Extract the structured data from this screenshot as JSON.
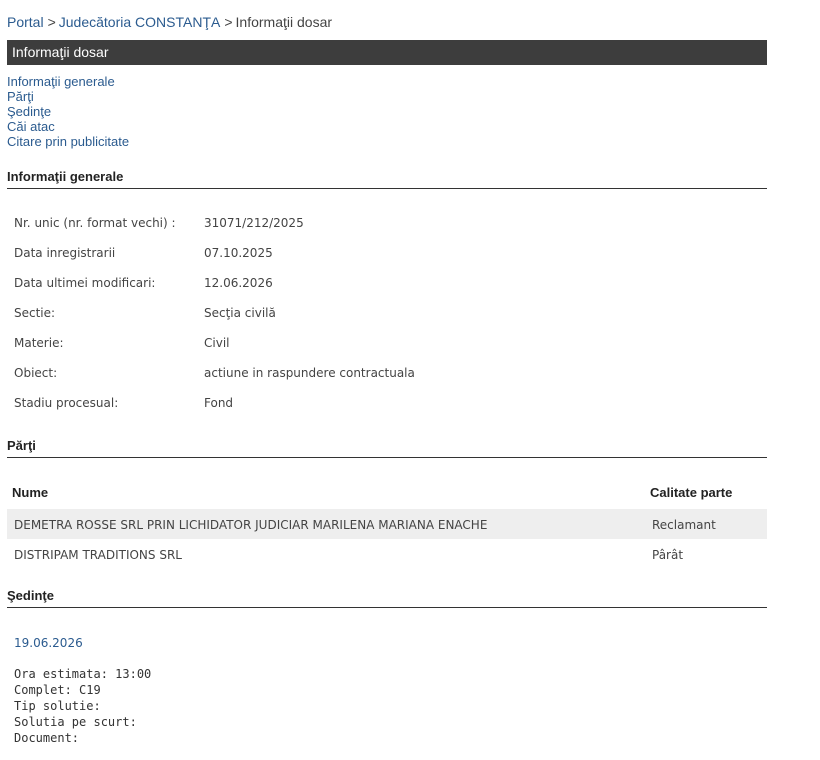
{
  "breadcrumb": {
    "portal": "Portal",
    "sep": ">",
    "court": "Judecătoria CONSTANŢA",
    "current": "Informaţii dosar"
  },
  "title_bar": "Informaţii dosar",
  "nav_links": [
    "Informaţii generale",
    "Părţi",
    "Şedinţe",
    "Căi atac",
    "Citare prin publicitate"
  ],
  "sections": {
    "general": "Informaţii generale",
    "parti": "Părţi",
    "sedinte": "Şedinţe"
  },
  "info": [
    {
      "label": "Nr. unic (nr. format vechi) :",
      "value": "31071/212/2025"
    },
    {
      "label": "Data inregistrarii",
      "value": "07.10.2025"
    },
    {
      "label": "Data ultimei modificari:",
      "value": "12.06.2026"
    },
    {
      "label": "Sectie:",
      "value": "Secţia civilă"
    },
    {
      "label": "Materie:",
      "value": "Civil"
    },
    {
      "label": "Obiect:",
      "value": "actiune in raspundere contractuala"
    },
    {
      "label": "Stadiu procesual:",
      "value": "Fond"
    }
  ],
  "parti": {
    "headers": {
      "nume": "Nume",
      "calitate": "Calitate parte"
    },
    "rows": [
      {
        "nume": "DEMETRA ROSSE SRL PRIN LICHIDATOR JUDICIAR MARILENA MARIANA ENACHE",
        "calitate": "Reclamant"
      },
      {
        "nume": "DISTRIPAM TRADITIONS SRL",
        "calitate": "Pârât"
      }
    ]
  },
  "sedinta": {
    "date": "19.06.2026",
    "ora": "Ora estimata: 13:00",
    "complet": "Complet: C19",
    "tip_solutie": "Tip solutie:",
    "solutia": "Solutia pe scurt:",
    "document": "Document:"
  }
}
